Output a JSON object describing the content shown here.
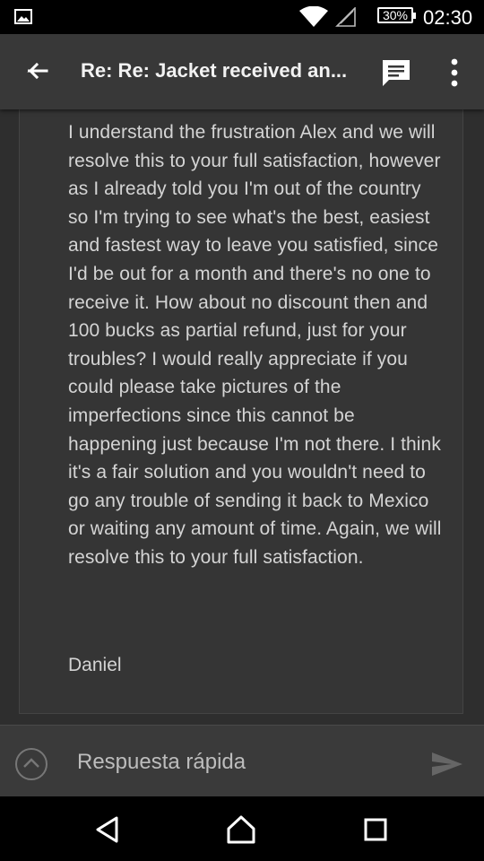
{
  "status_bar": {
    "battery": "30%",
    "time": "02:30",
    "icons": [
      "gallery-icon",
      "wifi-icon",
      "signal-icon",
      "battery-icon"
    ]
  },
  "app_bar": {
    "title": "Re: Re: Jacket received an...",
    "icons": [
      "back-arrow-icon",
      "reply-all-icon",
      "more-vert-icon"
    ]
  },
  "message": {
    "body": "I understand the frustration Alex and we will resolve this to your full satisfaction, however as I already told you I'm out of the country so I'm trying to see what's the best, easiest and fastest way to leave you satisfied, since I'd be out for a month and there's no one to receive it. How about no discount then and 100 bucks as partial refund, just for your troubles? I would really appreciate if you could please take pictures of the imperfections since this cannot be happening just because I'm not there. I think it's a fair solution and you wouldn't need to go any trouble of sending it back to Mexico or waiting any amount of time. Again, we will resolve this to your full satisfaction.",
    "signature": "Daniel"
  },
  "quick_reply": {
    "placeholder": "Respuesta rápida",
    "value": "",
    "icons": [
      "expand-icon",
      "send-icon"
    ]
  },
  "nav_bar": {
    "icons": [
      "back-nav-icon",
      "home-nav-icon",
      "recents-nav-icon"
    ]
  },
  "colors": {
    "background": "#2e2e2e",
    "app_bar": "#383838",
    "text": "#d4d4d4"
  }
}
